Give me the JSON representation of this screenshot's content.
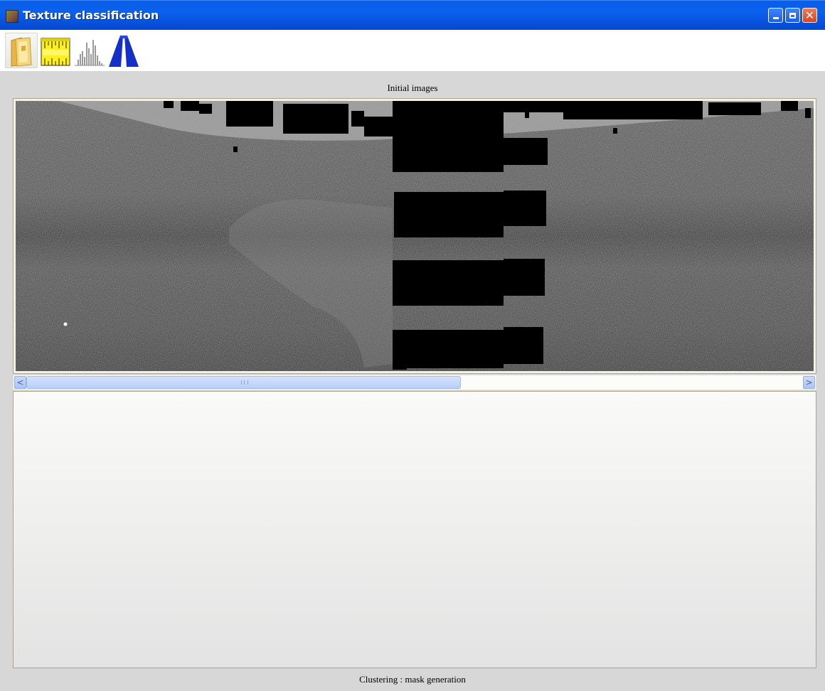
{
  "window": {
    "title": "Texture classification"
  },
  "toolbar": {
    "buttons": [
      {
        "icon": "folder-icon"
      },
      {
        "icon": "ruler-icon"
      },
      {
        "icon": "histogram-icon"
      },
      {
        "icon": "road-icon"
      }
    ]
  },
  "panels": {
    "top_caption": "Initial images",
    "bottom_caption": "Clustering : mask generation"
  },
  "scrollbar": {
    "left_arrow": "<",
    "right_arrow": ">",
    "position_fraction": 0.0
  },
  "colors": {
    "titlebar": "#0a5ee6",
    "panel_background": "#d7d7d7",
    "scroll_thumb": "#c4d6fb"
  }
}
